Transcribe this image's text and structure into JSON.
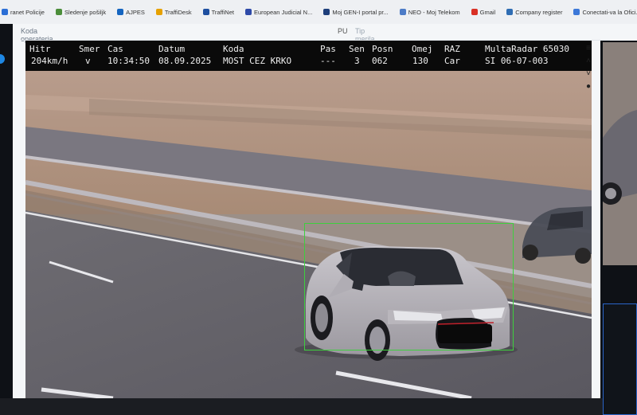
{
  "bookmarks": [
    {
      "label": "ranet Policije",
      "color": "#2c6fd6"
    },
    {
      "label": "Sledenje pošiljk",
      "color": "#4b8d3a"
    },
    {
      "label": "AJPES",
      "color": "#1565c0"
    },
    {
      "label": "TraffiDesk",
      "color": "#e6a100"
    },
    {
      "label": "TraffiNet",
      "color": "#1e4fa0"
    },
    {
      "label": "European Judicial N...",
      "color": "#2e4aa8"
    },
    {
      "label": "Moj GEN-I portal pr...",
      "color": "#1d3e7a"
    },
    {
      "label": "NEO - Moj Telekom",
      "color": "#4d7cc7"
    },
    {
      "label": "Gmail",
      "color": "#d93025"
    },
    {
      "label": "Company register",
      "color": "#2f6db3"
    },
    {
      "label": "Conectati-va la Ofici...",
      "color": "#3c78d8"
    }
  ],
  "form": {
    "koda_operaterja": "Koda operaterja",
    "pu": "PU",
    "tip_merila": "Tip merila"
  },
  "hud": {
    "headers": {
      "hitr": "Hitr",
      "smer": "Smer",
      "cas": "Cas",
      "datum": "Datum",
      "koda": "Koda",
      "pas": "Pas",
      "sen": "Sen",
      "posn": "Posn",
      "omej": "Omej",
      "raz": "RAZ",
      "device": "MultaRadar 65030"
    },
    "values": {
      "hitr": "204km/h",
      "smer": "v",
      "cas": "10:34:50",
      "datum": "08.09.2025",
      "koda": "MOST CEZ KRKO",
      "pas": "---",
      "sen": "3",
      "posn": "062",
      "omej": "130",
      "raz": "Car",
      "device_id": "SI 06-07-003"
    }
  },
  "toolbar": {
    "menu": "≡",
    "up": "˄",
    "down": "˅",
    "drop": "●"
  },
  "colors": {
    "detection_box": "#3ecf3e",
    "hud_bg": "#0a0a0a",
    "accent": "#1e88e5"
  }
}
